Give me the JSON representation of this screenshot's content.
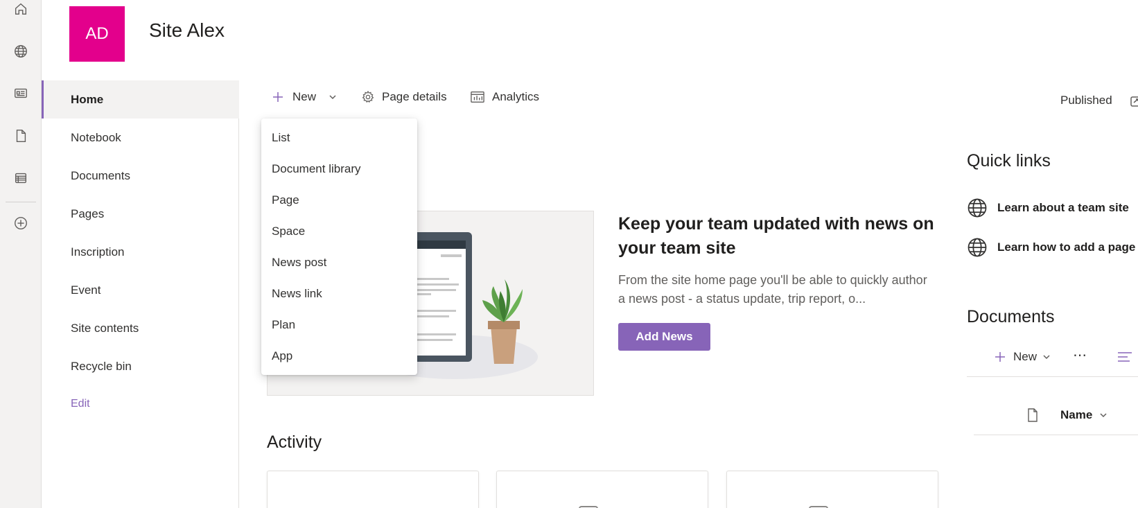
{
  "site": {
    "logo_initials": "AD",
    "title": "Site Alex",
    "logo_color": "#e3008c"
  },
  "rail": {
    "icons": [
      "home-icon",
      "globe-icon",
      "news-icon",
      "file-icon",
      "list-icon",
      "add-circle-icon"
    ]
  },
  "nav": {
    "items": [
      "Home",
      "Notebook",
      "Documents",
      "Pages",
      "Inscription",
      "Event",
      "Site contents",
      "Recycle bin"
    ],
    "selected": "Home",
    "edit_label": "Edit"
  },
  "commandbar": {
    "new_label": "New",
    "page_details_label": "Page details",
    "analytics_label": "Analytics",
    "status": "Published"
  },
  "new_menu": {
    "items": [
      "List",
      "Document library",
      "Page",
      "Space",
      "News post",
      "News link",
      "Plan",
      "App"
    ]
  },
  "news": {
    "title": "Keep your team updated with news on your team site",
    "description": "From the site home page you'll be able to quickly author a news post - a status update, trip report, o...",
    "button_label": "Add News"
  },
  "activity": {
    "title": "Activity"
  },
  "quick_links": {
    "title": "Quick links",
    "items": [
      "Learn about a team site",
      "Learn how to add a page"
    ]
  },
  "documents": {
    "title": "Documents",
    "new_label": "New",
    "column_name": "Name"
  },
  "colors": {
    "accent": "#8764b8",
    "brand": "#e3008c"
  }
}
